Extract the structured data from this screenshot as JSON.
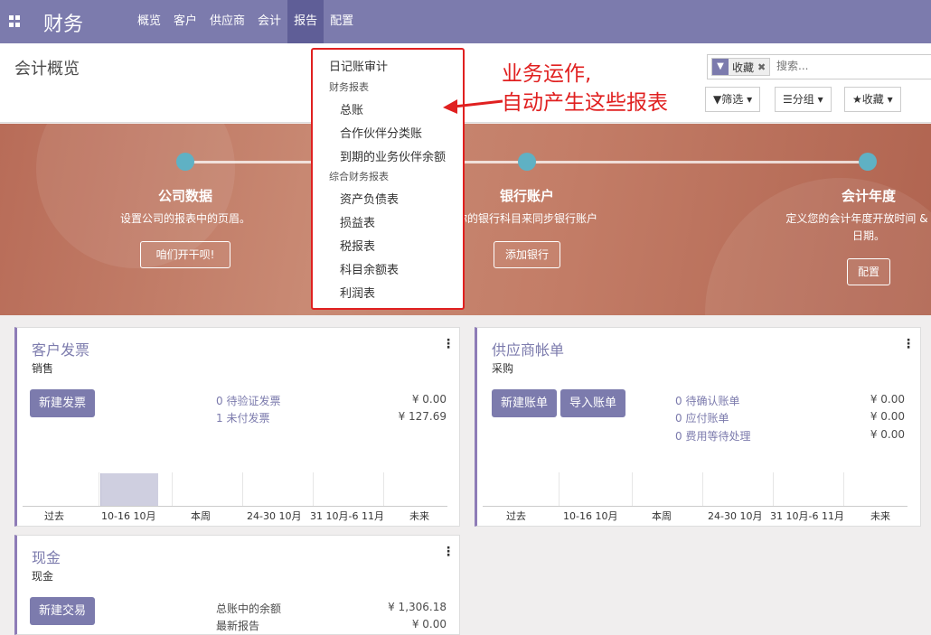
{
  "nav": {
    "brand": "财务",
    "menu": [
      "概览",
      "客户",
      "供应商",
      "会计",
      "报告",
      "配置"
    ]
  },
  "control": {
    "page_title": "会计概览",
    "facet": "收藏",
    "search_placeholder": "搜索...",
    "filter_label": "▼筛选",
    "group_label": "☰分组",
    "favorites_label": "★收藏"
  },
  "banner": {
    "steps": [
      {
        "title": "公司数据",
        "desc": "设置公司的报表中的页眉。",
        "button": "咱们开干呗!"
      },
      {
        "title": "银行账户",
        "desc": "你的银行科目来同步银行账户",
        "button": "添加银行"
      },
      {
        "title": "会计年度",
        "desc": "定义您的会计年度开放时间 &",
        "desc2": "日期。",
        "button": "配置"
      }
    ]
  },
  "dropdown": {
    "top": "日记账审计",
    "section1": "财务报表",
    "section1_items": [
      "总账",
      "合作伙伴分类账",
      "到期的业务伙伴余额"
    ],
    "section2": "综合财务报表",
    "section2_items": [
      "资产负债表",
      "损益表",
      "税报表",
      "科目余额表",
      "利润表"
    ]
  },
  "annotation": {
    "line1": "业务运作,",
    "line2": "自动产生这些报表"
  },
  "cards": {
    "customer": {
      "title": "客户发票",
      "subtitle": "销售",
      "button": "新建发票",
      "stats": [
        {
          "label": "0 待验证发票",
          "value": "¥ 0.00"
        },
        {
          "label": "1 未付发票",
          "value": "¥ 127.69"
        }
      ],
      "xlabels": [
        "过去",
        "10-16 10月",
        "本周",
        "24-30 10月",
        "31 10月-6 11月",
        "未来"
      ]
    },
    "vendor": {
      "title": "供应商帐单",
      "subtitle": "采购",
      "button1": "新建账单",
      "button2": "导入账单",
      "stats": [
        {
          "label": "0 待确认账单",
          "value": "¥ 0.00"
        },
        {
          "label": "0 应付账单",
          "value": "¥ 0.00"
        },
        {
          "label": "0 费用等待处理",
          "value": "¥ 0.00"
        }
      ],
      "xlabels": [
        "过去",
        "10-16 10月",
        "本周",
        "24-30 10月",
        "31 10月-6 11月",
        "未来"
      ]
    },
    "cash": {
      "title": "现金",
      "subtitle": "现金",
      "button": "新建交易",
      "stats": [
        {
          "label": "总账中的余额",
          "value": "¥ 1,306.18"
        },
        {
          "label": "最新报告",
          "value": "¥ 0.00"
        }
      ]
    }
  },
  "chart_data": {
    "type": "bar",
    "categories": [
      "过去",
      "10-16 10月",
      "本周",
      "24-30 10月",
      "31 10月-6 11月",
      "未来"
    ],
    "values": [
      0,
      127.69,
      0,
      0,
      0,
      0
    ]
  }
}
